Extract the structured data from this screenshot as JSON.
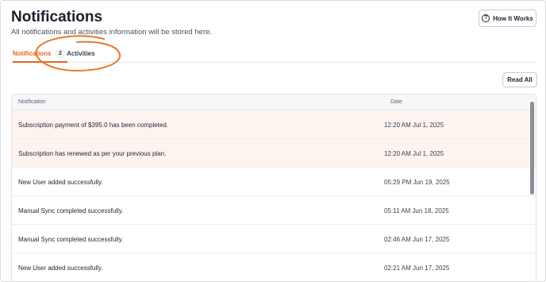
{
  "header": {
    "title": "Notifications",
    "subtitle": "All notifications and activities information will be stored here.",
    "how_it_works_label": "How It Works"
  },
  "tabs": [
    {
      "label": "Notifications",
      "count": "2",
      "active": true
    },
    {
      "label": "Activities",
      "active": false
    }
  ],
  "read_all_label": "Read All",
  "table": {
    "columns": [
      "Notification",
      "Date"
    ],
    "rows": [
      {
        "message": "Subscription payment of $395.0 has been completed.",
        "date": "12:20 AM Jul 1, 2025",
        "unread": true
      },
      {
        "message": "Subscription has renewed as per your previous plan.",
        "date": "12:20 AM Jul 1, 2025",
        "unread": true
      },
      {
        "message": "New User added successfully.",
        "date": "05:29 PM Jun 19, 2025",
        "unread": false
      },
      {
        "message": "Manual Sync completed successfully.",
        "date": "05:11 AM Jun 18, 2025",
        "unread": false
      },
      {
        "message": "Manual Sync completed successfully.",
        "date": "02:46 AM Jun 17, 2025",
        "unread": false
      },
      {
        "message": "New User added successfully.",
        "date": "02:21 AM Jun 17, 2025",
        "unread": false
      }
    ]
  },
  "colors": {
    "accent": "#e0671f",
    "unread_row_bg": "#fdf4ef",
    "annotation": "#e57a2c"
  },
  "icons": {
    "help": "question-circle-icon"
  }
}
